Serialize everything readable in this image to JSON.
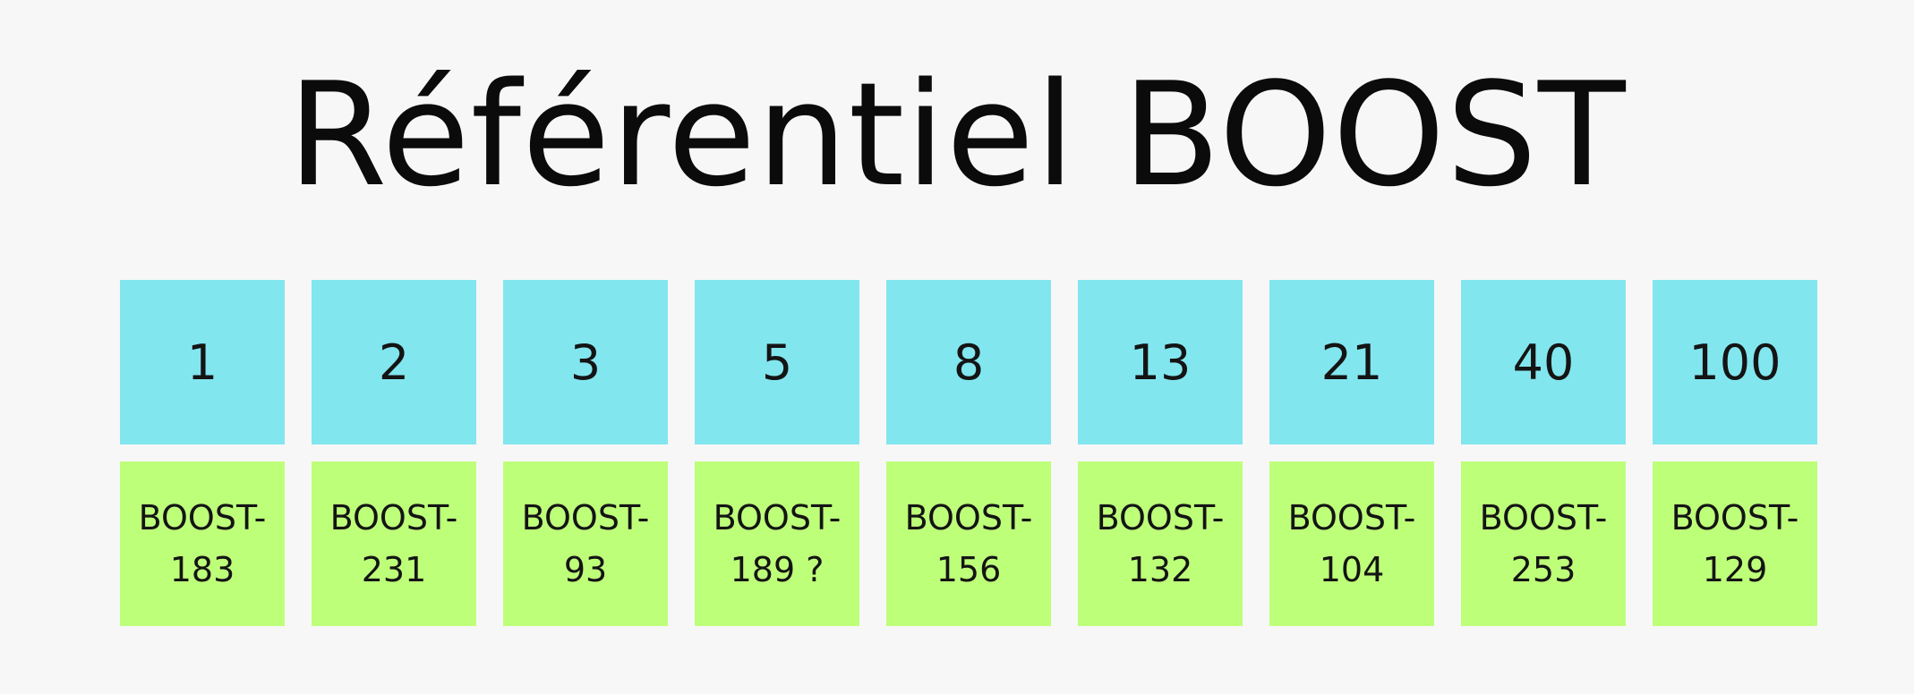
{
  "title": "Référentiel BOOST",
  "columns": [
    {
      "points": "1",
      "story": "BOOST-\n183"
    },
    {
      "points": "2",
      "story": "BOOST-\n231"
    },
    {
      "points": "3",
      "story": "BOOST-\n93"
    },
    {
      "points": "5",
      "story": "BOOST-\n189 ?"
    },
    {
      "points": "8",
      "story": "BOOST-\n156"
    },
    {
      "points": "13",
      "story": "BOOST-\n132"
    },
    {
      "points": "21",
      "story": "BOOST-\n104"
    },
    {
      "points": "40",
      "story": "BOOST-\n253"
    },
    {
      "points": "100",
      "story": "BOOST-\n129"
    }
  ],
  "colors": {
    "background": "#f7f7f7",
    "points_card": "#82e6ef",
    "story_card": "#beff7a",
    "text": "#141414"
  }
}
